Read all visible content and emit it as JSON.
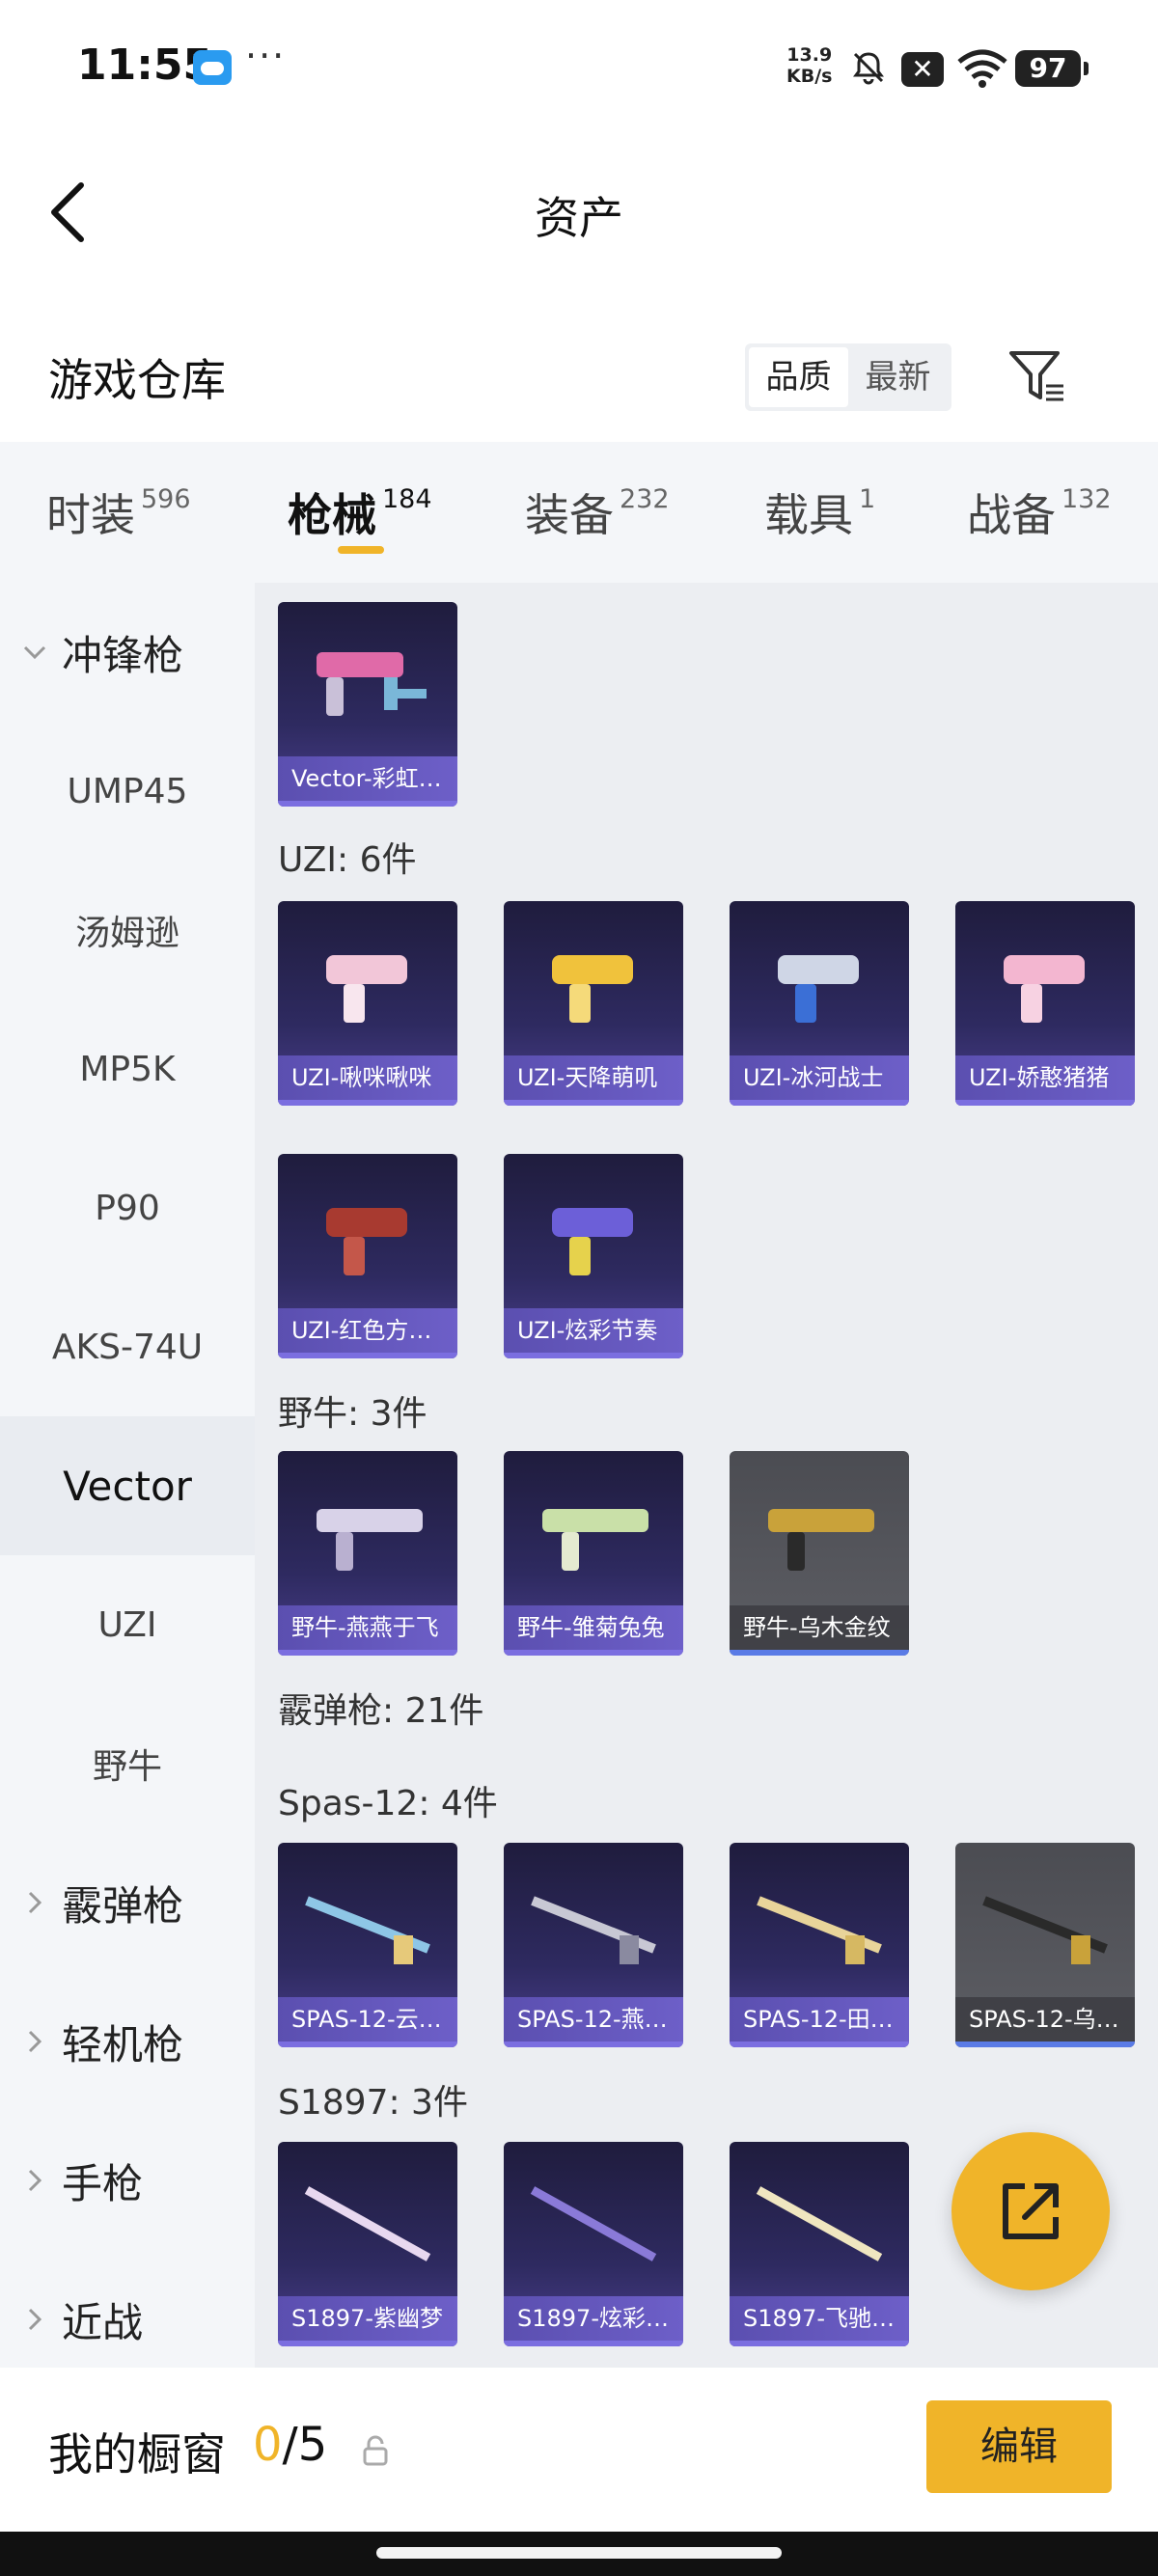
{
  "status_bar": {
    "time": "11:55",
    "dots": "···",
    "net_speed_value": "13.9",
    "net_speed_unit": "KB/s",
    "battery": "97"
  },
  "nav": {
    "title": "资产"
  },
  "warehouse": {
    "title": "游戏仓库",
    "sort_quality": "品质",
    "sort_newest": "最新"
  },
  "tabs": [
    {
      "label": "时装",
      "count": "596"
    },
    {
      "label": "枪械",
      "count": "184"
    },
    {
      "label": "装备",
      "count": "232"
    },
    {
      "label": "载具",
      "count": "1"
    },
    {
      "label": "战备",
      "count": "132"
    }
  ],
  "sidebar": {
    "groups": {
      "smg": "冲锋枪",
      "shotgun": "霰弹枪",
      "lmg": "轻机枪",
      "pistol": "手枪",
      "melee": "近战"
    },
    "items": [
      "UMP45",
      "汤姆逊",
      "MP5K",
      "P90",
      "AKS-74U",
      "Vector",
      "UZI",
      "野牛"
    ],
    "selected": "Vector"
  },
  "content": {
    "vector_cards": [
      "Vector-彩虹…"
    ],
    "uzi_label": "UZI: 6件",
    "uzi_cards": [
      "UZI-啾咪啾咪",
      "UZI-天降萌叽",
      "UZI-冰河战士",
      "UZI-娇憨猪猪",
      "UZI-红色方…",
      "UZI-炫彩节奏"
    ],
    "bison_label": "野牛: 3件",
    "bison_cards": [
      "野牛-燕燕于飞",
      "野牛-雏菊兔兔",
      "野牛-乌木金纹"
    ],
    "shotgun_label": "霰弹枪: 21件",
    "spas_label": "Spas-12: 4件",
    "spas_cards": [
      "SPAS-12-云…",
      "SPAS-12-燕…",
      "SPAS-12-田…",
      "SPAS-12-乌…"
    ],
    "s1897_label": "S1897: 3件",
    "s1897_cards": [
      "S1897-紫幽梦",
      "S1897-炫彩…",
      "S1897-飞驰…"
    ]
  },
  "bottom": {
    "showcase_title": "我的橱窗",
    "showcase_current": "0",
    "showcase_total": "/5",
    "edit_label": "编辑"
  },
  "colors": {
    "accent": "#f0b429",
    "card_purple": "#2e2a60",
    "card_label": "#5b4fb0"
  }
}
